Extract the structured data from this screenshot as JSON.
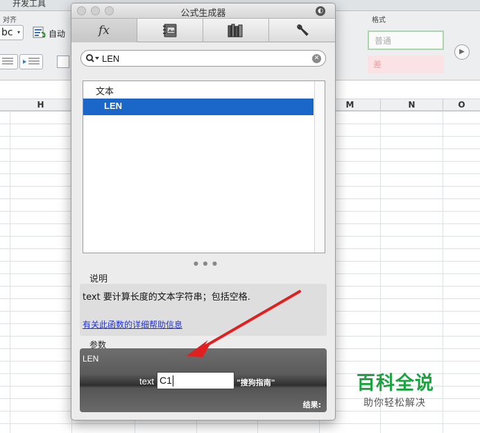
{
  "ribbon": {
    "developer_tab": "开发工具",
    "alignment_group": "对齐",
    "wrap_abc": "bc",
    "auto_label": "自动",
    "format_group": "格式",
    "style_normal": "普通",
    "style_bad": "差"
  },
  "columns": [
    "H",
    "M",
    "N",
    "O"
  ],
  "formula_builder": {
    "title": "公式生成器",
    "tabs": [
      {
        "name": "fx",
        "label": "fx"
      },
      {
        "name": "formula-library"
      },
      {
        "name": "function-library"
      },
      {
        "name": "settings"
      }
    ],
    "search": {
      "value": "LEN"
    },
    "list": {
      "category": "文本",
      "items": [
        "LEN"
      ]
    },
    "description": {
      "heading": "说明",
      "text": "text 要计算长度的文本字符串；包括空格.",
      "help_link": "有关此函数的详细帮助信息"
    },
    "arguments": {
      "heading": "参数",
      "function_name": "LEN",
      "arg_name": "text",
      "arg_input": "C1",
      "arg_value": "\"搜狗指南\"",
      "result_label": "结果:"
    }
  },
  "colors": {
    "selection": "#1a66c9",
    "annotation": "#e02020",
    "watermark": "#1aa33f"
  },
  "watermark": {
    "title": "百科全说",
    "subtitle": "助你轻松解决"
  }
}
